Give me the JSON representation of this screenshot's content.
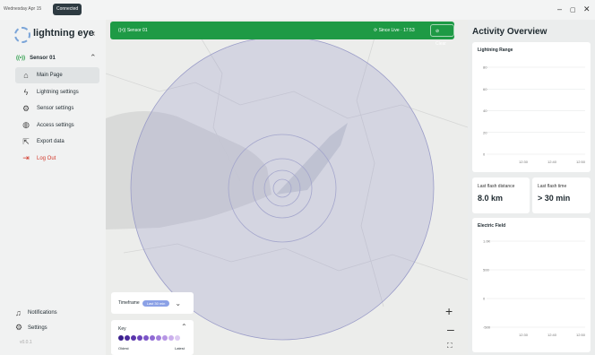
{
  "topbar": {
    "date": "Wednesday Apr 15",
    "status": "Connected",
    "minimize": "–",
    "maximize": "▢",
    "close": "✕"
  },
  "sidebar": {
    "brand": "lightning eye",
    "sensor": "Sensor 01",
    "items": [
      {
        "label": "Main Page",
        "icon": "home-icon",
        "glyph": "⌂",
        "active": true
      },
      {
        "label": "Lightning settings",
        "icon": "lightning-icon",
        "glyph": "ϟ"
      },
      {
        "label": "Sensor settings",
        "icon": "gear-icon",
        "glyph": "⚙"
      },
      {
        "label": "Access settings",
        "icon": "globe-icon",
        "glyph": "◍"
      },
      {
        "label": "Export data",
        "icon": "export-icon",
        "glyph": "⇱"
      },
      {
        "label": "Log Out",
        "icon": "logout-icon",
        "glyph": "⇥"
      }
    ],
    "notifications": "Notifications",
    "settings": "Settings",
    "version": "v0.0.1"
  },
  "map": {
    "sensor_name": "Sensor 01",
    "since": "Since Live · 17:53",
    "clear": "Clear",
    "timeframe_label": "Timeframe",
    "timeframe_value": "Last 30 min",
    "key_title": "Key",
    "key_oldest": "Oldest",
    "key_latest": "Latest",
    "key_colors": [
      "#3a1f8c",
      "#4a2a9c",
      "#5a36ac",
      "#6b44bb",
      "#7c55c8",
      "#8f69d3",
      "#a27fdc",
      "#b796e4",
      "#cbb0ec",
      "#dccaf2"
    ],
    "zoom_in": "+",
    "zoom_out": "–",
    "fullscreen": "⛶"
  },
  "panel": {
    "title": "Activity Overview",
    "range_title": "Lightning Range",
    "range_y_ticks": [
      "80",
      "60",
      "40",
      "20",
      "0"
    ],
    "range_x_ticks": [
      "12:30",
      "12:40",
      "12:50"
    ],
    "stat1_label": "Last flash distance",
    "stat1_value": "8.0 km",
    "stat2_label": "Last flash time",
    "stat2_value": "> 30 min",
    "field_title": "Electric Field",
    "field_y_ticks": [
      "1.0K",
      "500",
      "0",
      "-500"
    ],
    "field_x_ticks": [
      "12:30",
      "12:40",
      "12:50"
    ]
  },
  "chart_data": [
    {
      "type": "line",
      "title": "Lightning Range",
      "x": [
        "12:30",
        "12:40",
        "12:50"
      ],
      "ylim": [
        0,
        80
      ],
      "grid": true,
      "series": []
    },
    {
      "type": "line",
      "title": "Electric Field",
      "x": [
        "12:30",
        "12:40",
        "12:50"
      ],
      "ylim": [
        -500,
        1000
      ],
      "grid": true,
      "series": []
    }
  ]
}
